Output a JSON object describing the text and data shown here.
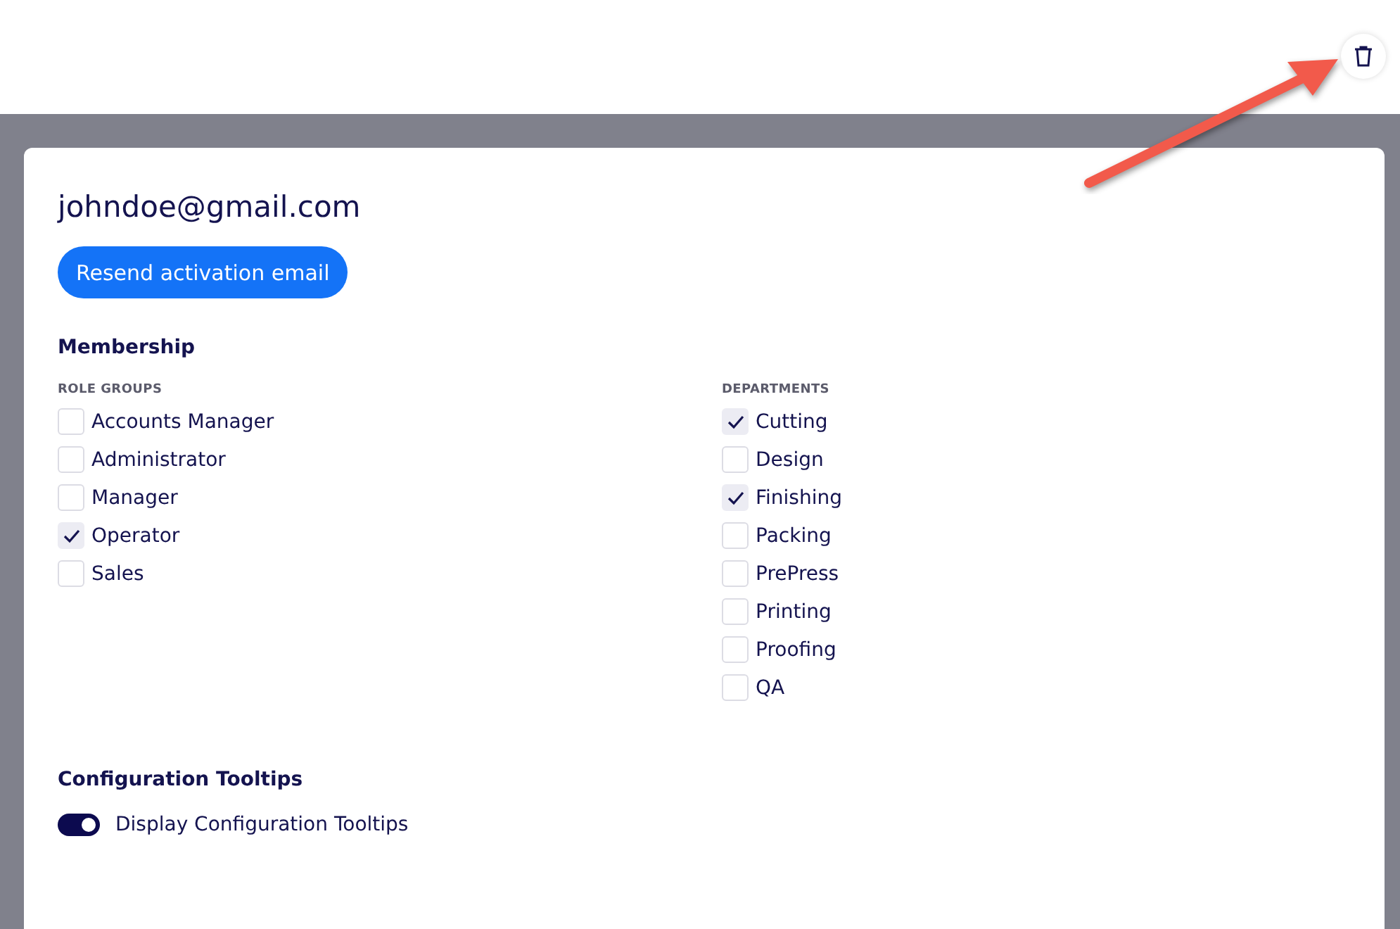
{
  "header": {
    "delete_button": {
      "kind": "trash"
    }
  },
  "user": {
    "email": "johndoe@gmail.com",
    "resend_button": "Resend activation email"
  },
  "membership": {
    "title": "Membership",
    "groups": [
      {
        "heading": "ROLE GROUPS",
        "items": [
          {
            "label": "Accounts Manager",
            "checked": false
          },
          {
            "label": "Administrator",
            "checked": false
          },
          {
            "label": "Manager",
            "checked": false
          },
          {
            "label": "Operator",
            "checked": true
          },
          {
            "label": "Sales",
            "checked": false
          }
        ]
      },
      {
        "heading": "DEPARTMENTS",
        "items": [
          {
            "label": "Cutting",
            "checked": true
          },
          {
            "label": "Design",
            "checked": false
          },
          {
            "label": "Finishing",
            "checked": true
          },
          {
            "label": "Packing",
            "checked": false
          },
          {
            "label": "PrePress",
            "checked": false
          },
          {
            "label": "Printing",
            "checked": false
          },
          {
            "label": "Proofing",
            "checked": false
          },
          {
            "label": "QA",
            "checked": false
          }
        ]
      }
    ]
  },
  "tooltips": {
    "title": "Configuration Tooltips",
    "label": "Display Configuration Tooltips",
    "on": true
  }
}
